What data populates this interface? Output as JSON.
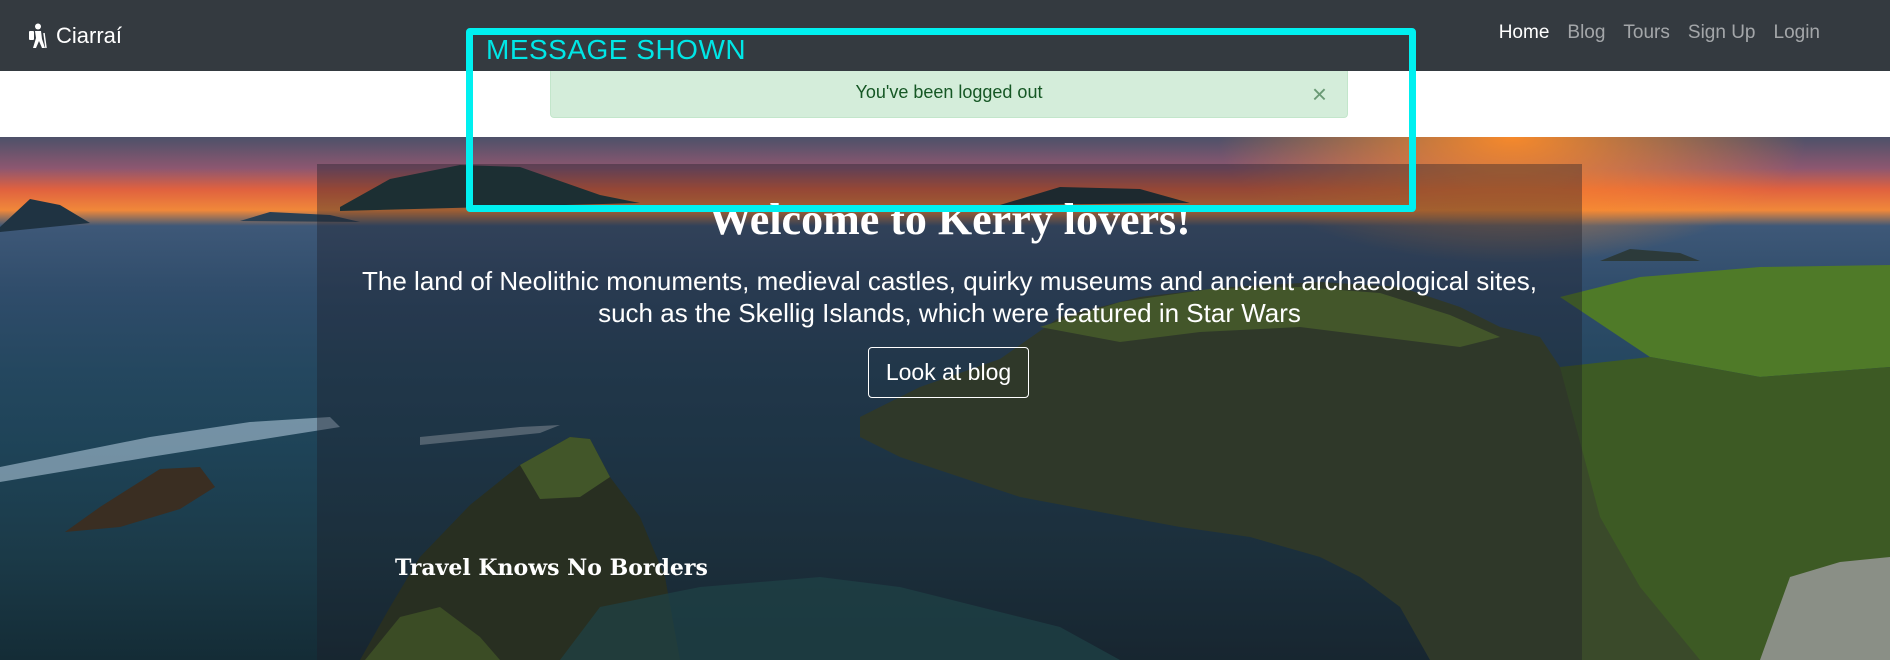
{
  "navbar": {
    "brand": "Ciarraí",
    "links": [
      "Home",
      "Blog",
      "Tours",
      "Sign Up",
      "Login"
    ]
  },
  "alert": {
    "message": "You've been logged out",
    "close": "×"
  },
  "hero": {
    "title": "Welcome to Kerry lovers!",
    "subtitle": "The land of Neolithic monuments, medieval castles, quirky museums and ancient archaeological sites, such as the Skellig Islands, which were featured in Star Wars",
    "button": "Look at blog",
    "footer": "Travel Knows No Borders"
  },
  "annotation": {
    "label": "MESSAGE SHOWN",
    "color": "#00f0f0"
  },
  "colors": {
    "navbar": "#343a40",
    "alert_bg": "#d4edda",
    "alert_text": "#155724"
  }
}
